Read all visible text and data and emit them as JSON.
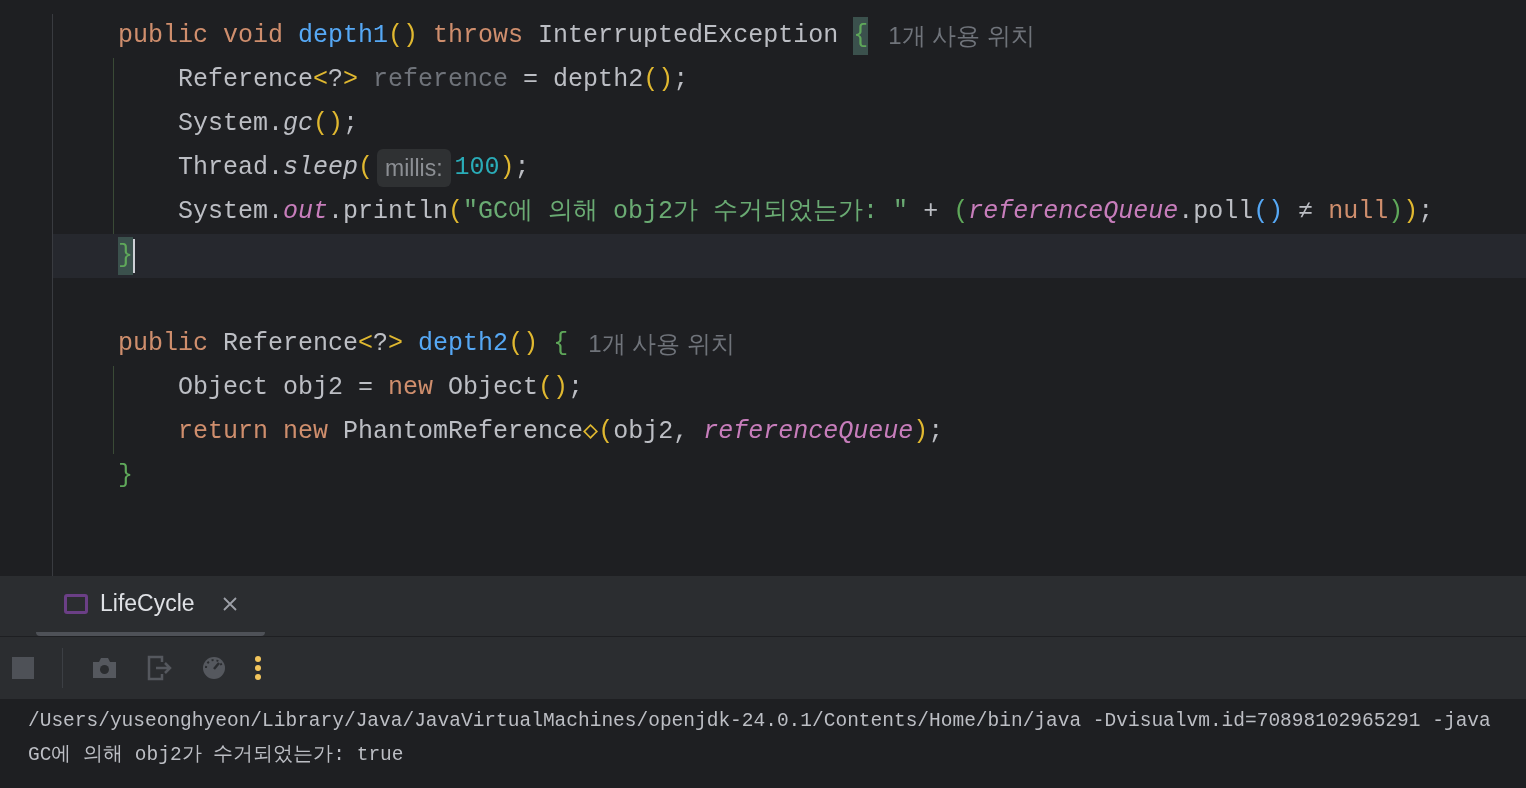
{
  "editor": {
    "methods": [
      {
        "signature": [
          {
            "kind": "kw",
            "text": "public void "
          },
          {
            "kind": "fn",
            "text": "depth1"
          },
          {
            "kind": "y",
            "text": "()"
          },
          {
            "kind": "kw",
            "text": " throws "
          },
          {
            "kind": "plain",
            "text": "InterruptedException "
          },
          {
            "kind": "gm",
            "text": "{"
          }
        ],
        "usage": "1개 사용 위치",
        "children": [
          {
            "tokens": [
              {
                "kind": "plain",
                "text": "Reference"
              },
              {
                "kind": "y",
                "text": "<"
              },
              {
                "kind": "plain",
                "text": "?"
              },
              {
                "kind": "y",
                "text": ">"
              },
              {
                "kind": "gray",
                "text": " reference"
              },
              {
                "kind": "plain",
                "text": " = depth2"
              },
              {
                "kind": "y",
                "text": "()"
              },
              {
                "kind": "plain",
                "text": ";"
              }
            ]
          },
          {
            "tokens": [
              {
                "kind": "plain",
                "text": "System."
              },
              {
                "kind": "static",
                "text": "gc"
              },
              {
                "kind": "y",
                "text": "()"
              },
              {
                "kind": "plain",
                "text": ";"
              }
            ]
          },
          {
            "tokens": [
              {
                "kind": "plain",
                "text": "Thread."
              },
              {
                "kind": "static",
                "text": "sleep"
              },
              {
                "kind": "y",
                "text": "("
              },
              {
                "kind": "hint",
                "text": "millis:"
              },
              {
                "kind": "num",
                "text": "100"
              },
              {
                "kind": "y",
                "text": ")"
              },
              {
                "kind": "plain",
                "text": ";"
              }
            ]
          },
          {
            "tokens": [
              {
                "kind": "plain",
                "text": "System."
              },
              {
                "kind": "field",
                "text": "out"
              },
              {
                "kind": "plain",
                "text": ".println"
              },
              {
                "kind": "y",
                "text": "("
              },
              {
                "kind": "str",
                "text": "\"GC에 의해 obj2가 수거되었는가: \""
              },
              {
                "kind": "plain",
                "text": " + "
              },
              {
                "kind": "g",
                "text": "("
              },
              {
                "kind": "field",
                "text": "referenceQueue"
              },
              {
                "kind": "plain",
                "text": ".poll"
              },
              {
                "kind": "b",
                "text": "()"
              },
              {
                "kind": "plain",
                "text": " ≠ "
              },
              {
                "kind": "kw",
                "text": "null"
              },
              {
                "kind": "g",
                "text": ")"
              },
              {
                "kind": "y",
                "text": ")"
              },
              {
                "kind": "plain",
                "text": ";"
              }
            ]
          }
        ],
        "closing": {
          "current": true,
          "tokens": [
            {
              "kind": "gm",
              "text": "}"
            }
          ]
        }
      },
      {
        "signature": [
          {
            "kind": "kw",
            "text": "public "
          },
          {
            "kind": "plain",
            "text": "Reference"
          },
          {
            "kind": "y",
            "text": "<"
          },
          {
            "kind": "plain",
            "text": "?"
          },
          {
            "kind": "y",
            "text": ">"
          },
          {
            "kind": "fn",
            "text": " depth2"
          },
          {
            "kind": "y",
            "text": "()"
          },
          {
            "kind": "g",
            "text": " {"
          }
        ],
        "usage": "1개 사용 위치",
        "children": [
          {
            "tokens": [
              {
                "kind": "plain",
                "text": "Object obj2 = "
              },
              {
                "kind": "kw",
                "text": "new "
              },
              {
                "kind": "plain",
                "text": "Object"
              },
              {
                "kind": "y",
                "text": "()"
              },
              {
                "kind": "plain",
                "text": ";"
              }
            ]
          },
          {
            "tokens": [
              {
                "kind": "kw",
                "text": "return new "
              },
              {
                "kind": "plain",
                "text": "PhantomReference"
              },
              {
                "kind": "y",
                "text": "◇("
              },
              {
                "kind": "plain",
                "text": "obj2, "
              },
              {
                "kind": "field",
                "text": "referenceQueue"
              },
              {
                "kind": "y",
                "text": ")"
              },
              {
                "kind": "plain",
                "text": ";"
              }
            ]
          }
        ],
        "closing": {
          "current": false,
          "tokens": [
            {
              "kind": "g",
              "text": "}"
            }
          ]
        }
      }
    ]
  },
  "run_panel": {
    "tabs": [
      {
        "label": "LifeCycle",
        "selected": true
      }
    ],
    "console": [
      "/Users/yuseonghyeon/Library/Java/JavaVirtualMachines/openjdk-24.0.1/Contents/Home/bin/java -Dvisualvm.id=70898102965291 -java",
      "GC에 의해 obj2가 수거되었는가: true"
    ]
  }
}
